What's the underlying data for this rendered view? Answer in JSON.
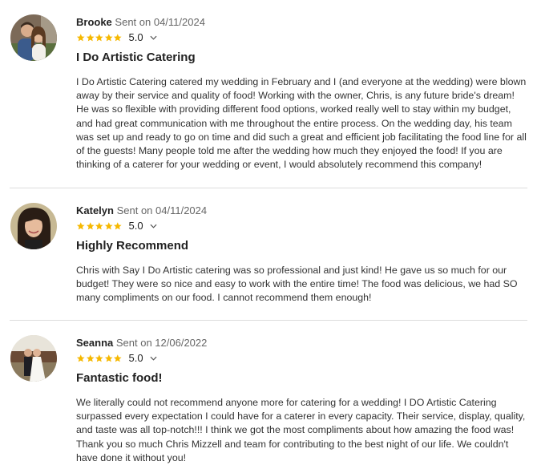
{
  "reviews": [
    {
      "name": "Brooke",
      "sent_label": "Sent on 04/11/2024",
      "rating": "5.0",
      "stars": 5,
      "title": "I Do Artistic Catering",
      "body": "I Do Artistic Catering catered my wedding in February and I (and everyone at the wedding) were blown away by their service and quality of food! Working with the owner, Chris, is any future bride's dream! He was so flexible with providing different food options, worked really well to stay within my budget, and had great communication with me throughout the entire process. On the wedding day, his team was set up and ready to go on time and did such a great and efficient job facilitating the food line for all of the guests! Many people told me after the wedding how much they enjoyed the food! If you are thinking of a caterer for your wedding or event, I would absolutely recommend this company!"
    },
    {
      "name": "Katelyn",
      "sent_label": "Sent on 04/11/2024",
      "rating": "5.0",
      "stars": 5,
      "title": "Highly Recommend",
      "body": "Chris with Say I Do Artistic catering was so professional and just kind! He gave us so much for our budget! They were so nice and easy to work with the entire time! The food was delicious, we had SO many compliments on our food. I cannot recommend them enough!"
    },
    {
      "name": "Seanna",
      "sent_label": "Sent on 12/06/2022",
      "rating": "5.0",
      "stars": 5,
      "title": "Fantastic food!",
      "body": "We literally could not recommend anyone more for catering for a wedding! I DO Artistic Catering surpassed every expectation I could have for a caterer in every capacity. Their service, display, quality, and taste was all top-notch!!! I think we got the most compliments about how amazing the food was! Thank you so much Chris Mizzell and team for contributing to the best night of our life. We couldn't have done it without you!"
    }
  ],
  "colors": {
    "star": "#f6b800",
    "divider": "#dddddd"
  }
}
